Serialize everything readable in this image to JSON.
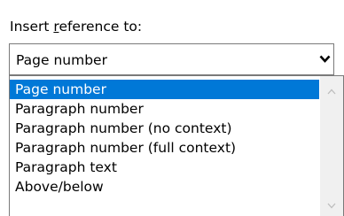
{
  "field_label": {
    "before": "Insert ",
    "mnemonic": "r",
    "after": "eference to:"
  },
  "combo": {
    "selected_value": "Page number",
    "arrow_icon": "chevron-down-icon"
  },
  "dropdown": {
    "items": [
      "Page number",
      "Paragraph number",
      "Paragraph number (no context)",
      "Paragraph number (full context)",
      "Paragraph text",
      "Above/below"
    ],
    "selected_index": 0,
    "scroll_up_icon": "chevron-up-icon",
    "scroll_down_icon": "chevron-down-icon"
  },
  "colors": {
    "selection": "#0078d7",
    "border": "#7a7a7a",
    "scrollbar_track": "#f0f0f0"
  }
}
